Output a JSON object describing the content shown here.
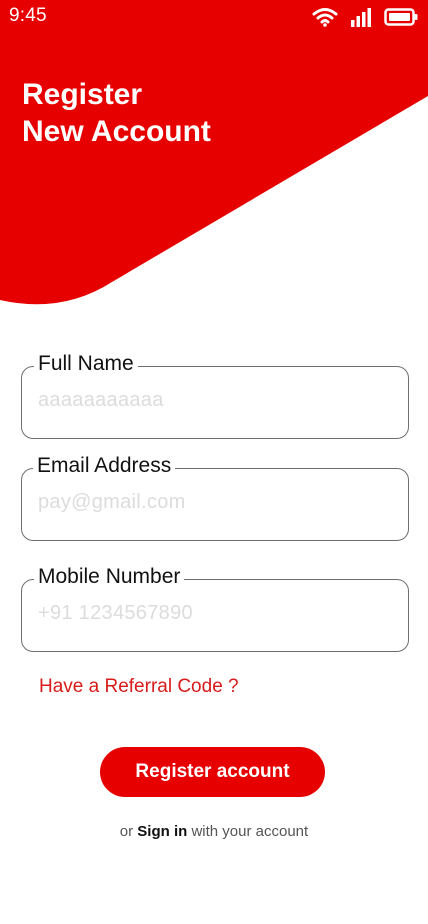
{
  "status": {
    "time": "9:45"
  },
  "header": {
    "title_line1": "Register",
    "title_line2": "New Account"
  },
  "form": {
    "full_name": {
      "label": "Full Name",
      "value": "aaaaaaaaaaa"
    },
    "email": {
      "label": "Email Address",
      "value": "pay@gmail.com"
    },
    "mobile": {
      "label": "Mobile Number",
      "value": "+91 1234567890"
    }
  },
  "referral_label": "Have a Referral Code ?",
  "register_label": "Register account",
  "signin": {
    "prefix": "or",
    "link": "Sign in",
    "suffix": "with your account"
  },
  "colors": {
    "brand": "#e60000",
    "link": "#d81b1b"
  }
}
